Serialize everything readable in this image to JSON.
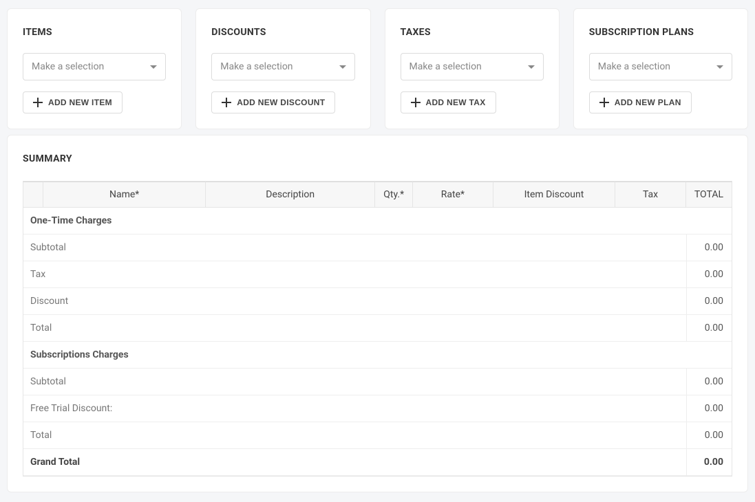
{
  "cards": {
    "items": {
      "title": "ITEMS",
      "placeholder": "Make a selection",
      "add_label": "ADD NEW ITEM"
    },
    "discounts": {
      "title": "DISCOUNTS",
      "placeholder": "Make a selection",
      "add_label": "ADD NEW DISCOUNT"
    },
    "taxes": {
      "title": "TAXES",
      "placeholder": "Make a selection",
      "add_label": "ADD NEW TAX"
    },
    "plans": {
      "title": "SUBSCRIPTION PLANS",
      "placeholder": "Make a selection",
      "add_label": "ADD NEW PLAN"
    }
  },
  "summary": {
    "title": "SUMMARY",
    "headers": {
      "name": "Name*",
      "description": "Description",
      "qty": "Qty.*",
      "rate": "Rate*",
      "item_discount": "Item Discount",
      "tax": "Tax",
      "total": "TOTAL"
    },
    "sections": {
      "onetime": {
        "header": "One-Time Charges",
        "rows": [
          {
            "label": "Subtotal",
            "value": "0.00"
          },
          {
            "label": "Tax",
            "value": "0.00"
          },
          {
            "label": "Discount",
            "value": "0.00"
          },
          {
            "label": "Total",
            "value": "0.00"
          }
        ]
      },
      "subscriptions": {
        "header": "Subscriptions Charges",
        "rows": [
          {
            "label": "Subtotal",
            "value": "0.00"
          },
          {
            "label": "Free Trial Discount:",
            "value": "0.00"
          },
          {
            "label": "Total",
            "value": "0.00"
          }
        ]
      },
      "grand": {
        "label": "Grand Total",
        "value": "0.00"
      }
    }
  }
}
